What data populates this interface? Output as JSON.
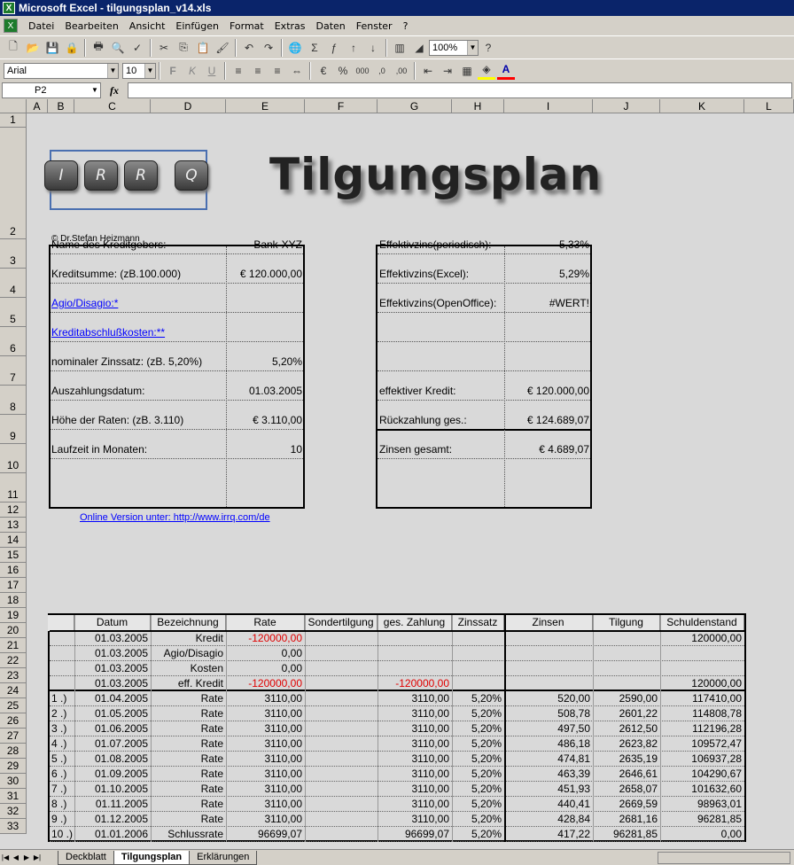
{
  "window": {
    "title": "Microsoft Excel - tilgungsplan_v14.xls"
  },
  "menu": [
    "Datei",
    "Bearbeiten",
    "Ansicht",
    "Einfügen",
    "Format",
    "Extras",
    "Daten",
    "Fenster",
    "?"
  ],
  "toolbar": {
    "zoom": "100%",
    "font": "Arial",
    "size": "10"
  },
  "formula_bar": {
    "cell_ref": "P2",
    "fx": "fx",
    "content": ""
  },
  "columns": [
    "A",
    "B",
    "C",
    "D",
    "E",
    "F",
    "G",
    "H",
    "I",
    "J",
    "K",
    "L"
  ],
  "header": {
    "keys": [
      "I",
      "R",
      "R",
      "Q"
    ],
    "title": "Tilgungsplan",
    "copyright": "© Dr.Stefan Heizmann",
    "online": "Online Version unter: http://www.irrq.com/de"
  },
  "inputs": [
    {
      "label": "Name des Kreditgebers:",
      "value": "Bank-XYZ",
      "link": false
    },
    {
      "label": "Kreditsumme: (zB.100.000)",
      "value": "€ 120.000,00",
      "link": false
    },
    {
      "label": "Agio/Disagio:*",
      "value": "",
      "link": true
    },
    {
      "label": "Kreditabschlußkosten:**",
      "value": "",
      "link": true
    },
    {
      "label": "nominaler Zinssatz: (zB. 5,20%)",
      "value": "5,20%",
      "link": false
    },
    {
      "label": "Auszahlungsdatum:",
      "value": "01.03.2005",
      "link": false
    },
    {
      "label": "Höhe der Raten: (zB. 3.110)",
      "value": "€ 3.110,00",
      "link": false
    },
    {
      "label": "Laufzeit in Monaten:",
      "value": "10",
      "link": false
    }
  ],
  "results": [
    {
      "label": "Effektivzins(periodisch):",
      "value": "5,33%"
    },
    {
      "label": "Effektivzins(Excel):",
      "value": "5,29%"
    },
    {
      "label": "Effektivzins(OpenOffice):",
      "value": "#WERT!"
    },
    {
      "label": "",
      "value": ""
    },
    {
      "label": "",
      "value": ""
    },
    {
      "label": "effektiver Kredit:",
      "value": "€ 120.000,00"
    },
    {
      "label": "Rückzahlung ges.:",
      "value": "€ 124.689,07"
    },
    {
      "label": "Zinsen gesamt:",
      "value": "€ 4.689,07"
    }
  ],
  "table": {
    "headers": [
      "",
      "Datum",
      "Bezeichnung",
      "Rate",
      "Sondertilgung",
      "ges. Zahlung",
      "Zinssatz",
      "Zinsen",
      "Tilgung",
      "Schuldenstand"
    ],
    "rows": [
      [
        "",
        "01.03.2005",
        "Kredit",
        "-120000,00",
        "",
        "",
        "",
        "",
        "",
        "120000,00"
      ],
      [
        "",
        "01.03.2005",
        "Agio/Disagio",
        "0,00",
        "",
        "",
        "",
        "",
        "",
        ""
      ],
      [
        "",
        "01.03.2005",
        "Kosten",
        "0,00",
        "",
        "",
        "",
        "",
        "",
        ""
      ],
      [
        "",
        "01.03.2005",
        "eff. Kredit",
        "-120000,00",
        "",
        "-120000,00",
        "",
        "",
        "",
        "120000,00"
      ],
      [
        "1 .)",
        "01.04.2005",
        "Rate",
        "3110,00",
        "",
        "3110,00",
        "5,20%",
        "520,00",
        "2590,00",
        "117410,00"
      ],
      [
        "2 .)",
        "01.05.2005",
        "Rate",
        "3110,00",
        "",
        "3110,00",
        "5,20%",
        "508,78",
        "2601,22",
        "114808,78"
      ],
      [
        "3 .)",
        "01.06.2005",
        "Rate",
        "3110,00",
        "",
        "3110,00",
        "5,20%",
        "497,50",
        "2612,50",
        "112196,28"
      ],
      [
        "4 .)",
        "01.07.2005",
        "Rate",
        "3110,00",
        "",
        "3110,00",
        "5,20%",
        "486,18",
        "2623,82",
        "109572,47"
      ],
      [
        "5 .)",
        "01.08.2005",
        "Rate",
        "3110,00",
        "",
        "3110,00",
        "5,20%",
        "474,81",
        "2635,19",
        "106937,28"
      ],
      [
        "6 .)",
        "01.09.2005",
        "Rate",
        "3110,00",
        "",
        "3110,00",
        "5,20%",
        "463,39",
        "2646,61",
        "104290,67"
      ],
      [
        "7 .)",
        "01.10.2005",
        "Rate",
        "3110,00",
        "",
        "3110,00",
        "5,20%",
        "451,93",
        "2658,07",
        "101632,60"
      ],
      [
        "8 .)",
        "01.11.2005",
        "Rate",
        "3110,00",
        "",
        "3110,00",
        "5,20%",
        "440,41",
        "2669,59",
        "98963,01"
      ],
      [
        "9 .)",
        "01.12.2005",
        "Rate",
        "3110,00",
        "",
        "3110,00",
        "5,20%",
        "428,84",
        "2681,16",
        "96281,85"
      ],
      [
        "10 .)",
        "01.01.2006",
        "Schlussrate",
        "96699,07",
        "",
        "96699,07",
        "5,20%",
        "417,22",
        "96281,85",
        "0,00"
      ]
    ]
  },
  "sheet_tabs": [
    "Deckblatt",
    "Tilgungsplan",
    "Erklärungen"
  ],
  "active_tab": "Tilgungsplan",
  "colors": {
    "title_bar": "#0a246a",
    "link": "#0000ff",
    "negative": "#e00000"
  }
}
